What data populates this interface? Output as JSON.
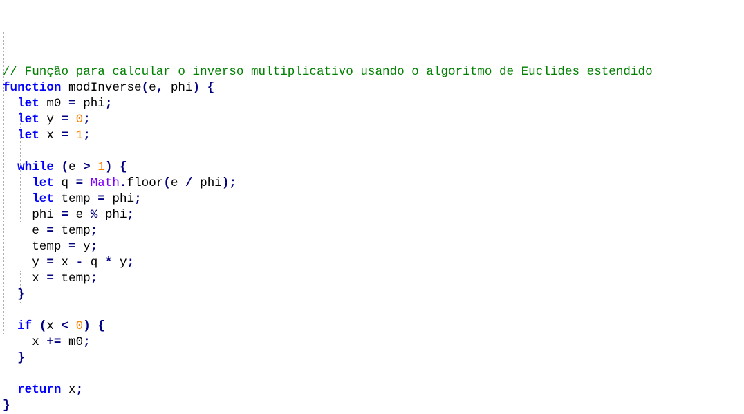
{
  "colors": {
    "keyword": "#0000ff",
    "operator": "#000080",
    "number": "#ff8000",
    "builtin": "#8000ff",
    "comment": "#008000",
    "text": "#000000"
  },
  "code": {
    "lines": [
      [
        {
          "t": "comment",
          "v": "// Função para calcular o inverso multiplicativo usando o algoritmo de Euclides estendido"
        }
      ],
      [
        {
          "t": "keyword",
          "v": "function"
        },
        {
          "t": "ident",
          "v": " modInverse"
        },
        {
          "t": "op",
          "v": "("
        },
        {
          "t": "ident",
          "v": "e"
        },
        {
          "t": "op",
          "v": ","
        },
        {
          "t": "ident",
          "v": " phi"
        },
        {
          "t": "op",
          "v": ")"
        },
        {
          "t": "ident",
          "v": " "
        },
        {
          "t": "op",
          "v": "{"
        }
      ],
      [
        {
          "t": "ident",
          "v": "  "
        },
        {
          "t": "keyword",
          "v": "let"
        },
        {
          "t": "ident",
          "v": " m0 "
        },
        {
          "t": "op",
          "v": "="
        },
        {
          "t": "ident",
          "v": " phi"
        },
        {
          "t": "op",
          "v": ";"
        }
      ],
      [
        {
          "t": "ident",
          "v": "  "
        },
        {
          "t": "keyword",
          "v": "let"
        },
        {
          "t": "ident",
          "v": " y "
        },
        {
          "t": "op",
          "v": "="
        },
        {
          "t": "ident",
          "v": " "
        },
        {
          "t": "number",
          "v": "0"
        },
        {
          "t": "op",
          "v": ";"
        }
      ],
      [
        {
          "t": "ident",
          "v": "  "
        },
        {
          "t": "keyword",
          "v": "let"
        },
        {
          "t": "ident",
          "v": " x "
        },
        {
          "t": "op",
          "v": "="
        },
        {
          "t": "ident",
          "v": " "
        },
        {
          "t": "number",
          "v": "1"
        },
        {
          "t": "op",
          "v": ";"
        }
      ],
      [],
      [
        {
          "t": "ident",
          "v": "  "
        },
        {
          "t": "keyword",
          "v": "while"
        },
        {
          "t": "ident",
          "v": " "
        },
        {
          "t": "op",
          "v": "("
        },
        {
          "t": "ident",
          "v": "e "
        },
        {
          "t": "op",
          "v": ">"
        },
        {
          "t": "ident",
          "v": " "
        },
        {
          "t": "number",
          "v": "1"
        },
        {
          "t": "op",
          "v": ")"
        },
        {
          "t": "ident",
          "v": " "
        },
        {
          "t": "op",
          "v": "{"
        }
      ],
      [
        {
          "t": "ident",
          "v": "    "
        },
        {
          "t": "keyword",
          "v": "let"
        },
        {
          "t": "ident",
          "v": " q "
        },
        {
          "t": "op",
          "v": "="
        },
        {
          "t": "ident",
          "v": " "
        },
        {
          "t": "builtin",
          "v": "Math"
        },
        {
          "t": "op",
          "v": "."
        },
        {
          "t": "ident",
          "v": "floor"
        },
        {
          "t": "op",
          "v": "("
        },
        {
          "t": "ident",
          "v": "e "
        },
        {
          "t": "op",
          "v": "/"
        },
        {
          "t": "ident",
          "v": " phi"
        },
        {
          "t": "op",
          "v": ");"
        }
      ],
      [
        {
          "t": "ident",
          "v": "    "
        },
        {
          "t": "keyword",
          "v": "let"
        },
        {
          "t": "ident",
          "v": " temp "
        },
        {
          "t": "op",
          "v": "="
        },
        {
          "t": "ident",
          "v": " phi"
        },
        {
          "t": "op",
          "v": ";"
        }
      ],
      [
        {
          "t": "ident",
          "v": "    phi "
        },
        {
          "t": "op",
          "v": "="
        },
        {
          "t": "ident",
          "v": " e "
        },
        {
          "t": "op",
          "v": "%"
        },
        {
          "t": "ident",
          "v": " phi"
        },
        {
          "t": "op",
          "v": ";"
        }
      ],
      [
        {
          "t": "ident",
          "v": "    e "
        },
        {
          "t": "op",
          "v": "="
        },
        {
          "t": "ident",
          "v": " temp"
        },
        {
          "t": "op",
          "v": ";"
        }
      ],
      [
        {
          "t": "ident",
          "v": "    temp "
        },
        {
          "t": "op",
          "v": "="
        },
        {
          "t": "ident",
          "v": " y"
        },
        {
          "t": "op",
          "v": ";"
        }
      ],
      [
        {
          "t": "ident",
          "v": "    y "
        },
        {
          "t": "op",
          "v": "="
        },
        {
          "t": "ident",
          "v": " x "
        },
        {
          "t": "op",
          "v": "-"
        },
        {
          "t": "ident",
          "v": " q "
        },
        {
          "t": "op",
          "v": "*"
        },
        {
          "t": "ident",
          "v": " y"
        },
        {
          "t": "op",
          "v": ";"
        }
      ],
      [
        {
          "t": "ident",
          "v": "    x "
        },
        {
          "t": "op",
          "v": "="
        },
        {
          "t": "ident",
          "v": " temp"
        },
        {
          "t": "op",
          "v": ";"
        }
      ],
      [
        {
          "t": "ident",
          "v": "  "
        },
        {
          "t": "op",
          "v": "}"
        }
      ],
      [],
      [
        {
          "t": "ident",
          "v": "  "
        },
        {
          "t": "keyword",
          "v": "if"
        },
        {
          "t": "ident",
          "v": " "
        },
        {
          "t": "op",
          "v": "("
        },
        {
          "t": "ident",
          "v": "x "
        },
        {
          "t": "op",
          "v": "<"
        },
        {
          "t": "ident",
          "v": " "
        },
        {
          "t": "number",
          "v": "0"
        },
        {
          "t": "op",
          "v": ")"
        },
        {
          "t": "ident",
          "v": " "
        },
        {
          "t": "op",
          "v": "{"
        }
      ],
      [
        {
          "t": "ident",
          "v": "    x "
        },
        {
          "t": "op",
          "v": "+="
        },
        {
          "t": "ident",
          "v": " m0"
        },
        {
          "t": "op",
          "v": ";"
        }
      ],
      [
        {
          "t": "ident",
          "v": "  "
        },
        {
          "t": "op",
          "v": "}"
        }
      ],
      [],
      [
        {
          "t": "ident",
          "v": "  "
        },
        {
          "t": "keyword",
          "v": "return"
        },
        {
          "t": "ident",
          "v": " x"
        },
        {
          "t": "op",
          "v": ";"
        }
      ],
      [
        {
          "t": "op",
          "v": "}"
        }
      ]
    ]
  }
}
